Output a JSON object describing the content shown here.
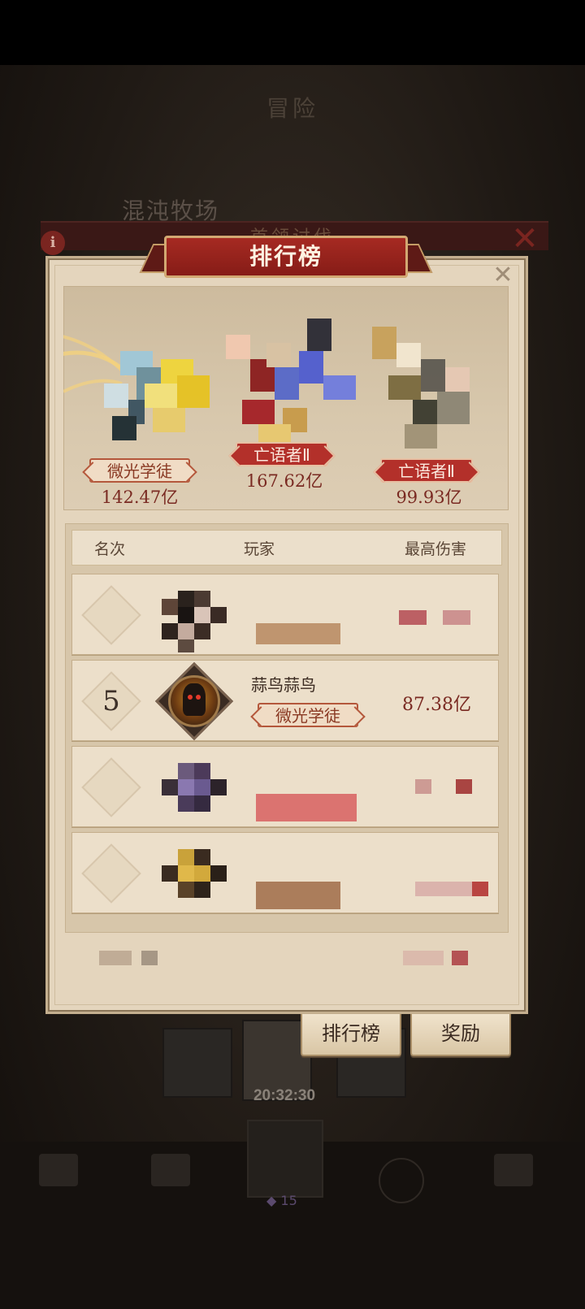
{
  "background": {
    "title": "冒险",
    "chaos_label": "混沌牧场",
    "boss_title": "首领讨伐",
    "timer": "20:32:30",
    "crystals": "15"
  },
  "modal": {
    "title": "排行榜",
    "podium": [
      {
        "name": "",
        "tag": "微光学徒",
        "damage": "142.47亿"
      },
      {
        "tag": "亡语者Ⅱ",
        "damage": "167.62亿"
      },
      {
        "tag": "亡语者Ⅱ",
        "damage": "99.93亿"
      }
    ],
    "table_headers": {
      "rank": "名次",
      "player": "玩家",
      "damage": "最高伤害"
    },
    "rows": [
      {
        "rank": "",
        "name": "",
        "tag": "",
        "damage": ""
      },
      {
        "rank": "5",
        "name": "蒜鸟蒜鸟",
        "tag": "微光学徒",
        "damage": "87.38亿"
      },
      {
        "rank": "",
        "name": "",
        "tag": "",
        "damage": ""
      },
      {
        "rank": "",
        "name": "",
        "tag": "",
        "damage": ""
      }
    ]
  },
  "buttons": {
    "leaderboard": "排行榜",
    "rewards": "奖励"
  },
  "colors": {
    "accent_red": "#a62a22",
    "parchment": "#e4d5bd",
    "damage_text": "#7a2a22"
  }
}
